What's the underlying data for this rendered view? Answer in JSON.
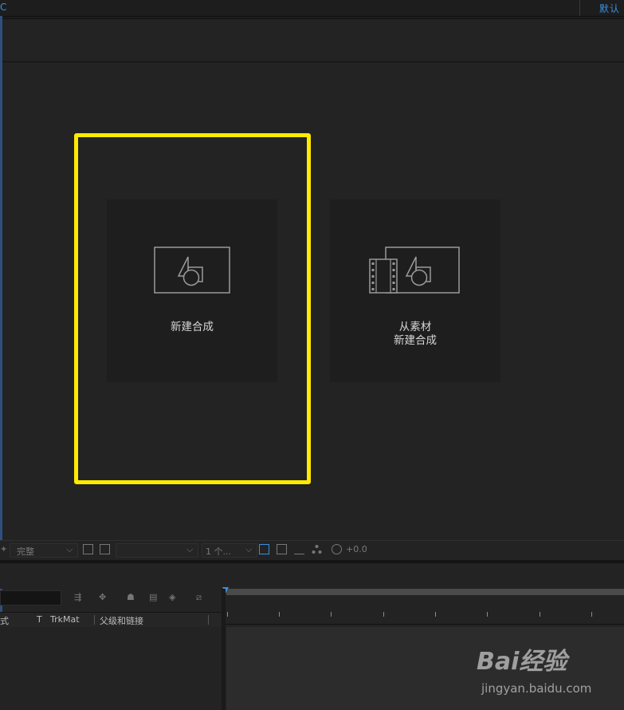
{
  "topbar": {
    "left_fragment": "C",
    "right_text": "默认"
  },
  "composition_panel": {
    "tiles": [
      {
        "label": "新建合成",
        "icon": "composition-icon"
      },
      {
        "label_line1": "从素材",
        "label_line2": "新建合成",
        "icon": "composition-from-footage-icon"
      }
    ],
    "highlight_color": "#ffea00"
  },
  "comp_footer": {
    "resolution": "完整",
    "view_count": "1 个...",
    "exposure": "+0.0"
  },
  "timeline": {
    "columns": {
      "mode_fragment": "式",
      "t": "T",
      "trkmat": "TrkMat",
      "parent": "父级和链接"
    }
  },
  "watermark": {
    "brand": "Bai经验",
    "url": "jingyan.baidu.com"
  },
  "colors": {
    "accent": "#3a8fe0",
    "panel_bg": "#232323",
    "tile_bg": "#1e1e1e"
  }
}
